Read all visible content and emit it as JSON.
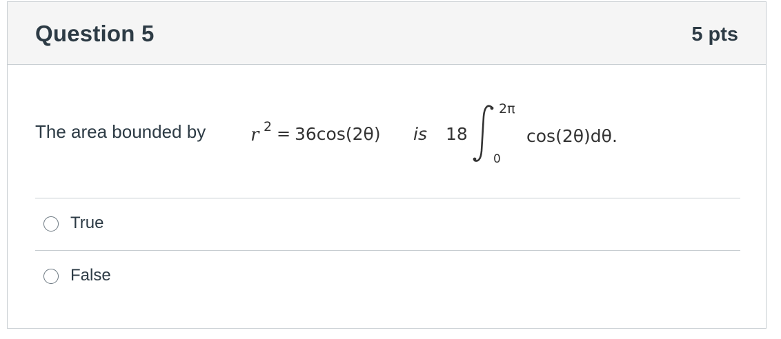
{
  "question": {
    "title": "Question 5",
    "points": "5 pts",
    "prefix": "The area bounded by",
    "equation": {
      "r": "r",
      "r_exponent": "2",
      "equals": "=",
      "rhs": "36cos(2θ)",
      "is": "is",
      "coefficient": "18",
      "integral_upper": "2π",
      "integral_lower": "0",
      "integrand": "cos(2θ)dθ."
    }
  },
  "answers": [
    {
      "label": "True",
      "selected": false
    },
    {
      "label": "False",
      "selected": false
    }
  ]
}
